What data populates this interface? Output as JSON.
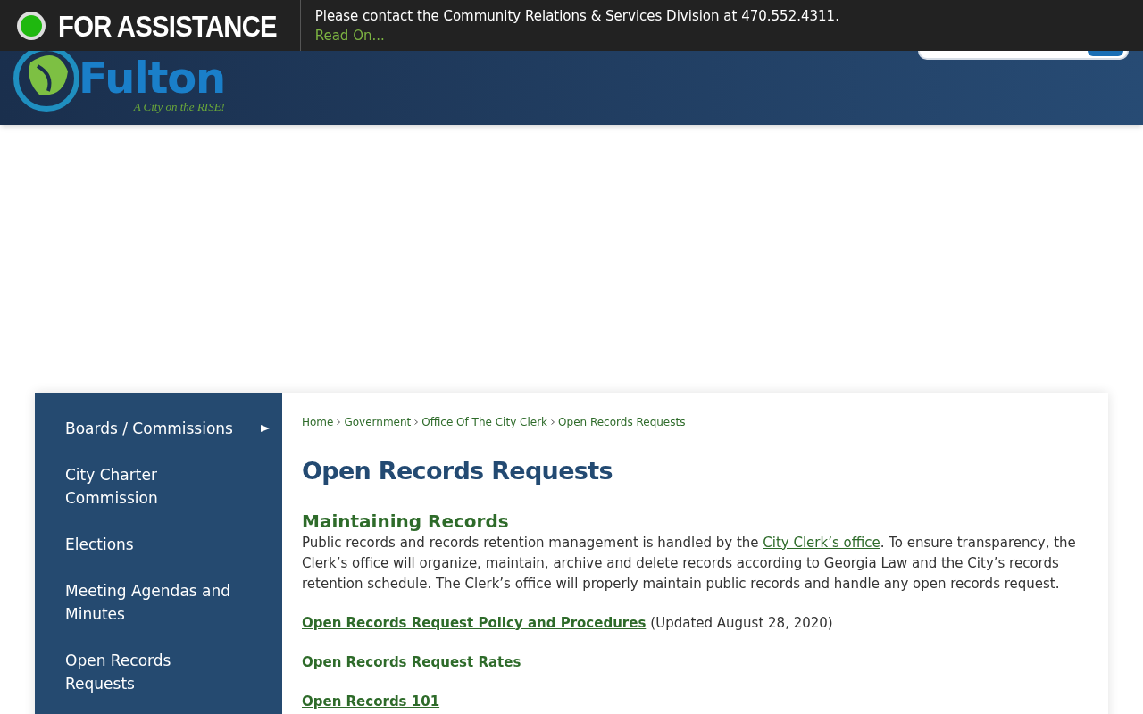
{
  "alert_banner": {
    "title": "FOR ASSISTANCE",
    "message": "Please contact the Community Relations & Services Division at 470.552.4311.",
    "link": "Read On..."
  },
  "header": {
    "logo_text": "Fulton",
    "logo_tagline": "A City on the RISE!"
  },
  "sidebar": {
    "items": [
      {
        "label": "Boards / Commissions",
        "has_submenu": true
      },
      {
        "label": "City Charter Commission",
        "has_submenu": false
      },
      {
        "label": "Elections",
        "has_submenu": false
      },
      {
        "label": "Meeting Agendas and Minutes",
        "has_submenu": false
      },
      {
        "label": "Open Records Requests",
        "has_submenu": false
      }
    ]
  },
  "breadcrumbs": [
    "Home",
    "Government",
    "Office Of The City Clerk",
    "Open Records Requests"
  ],
  "page_title": "Open Records Requests",
  "section_title": "Maintaining Records",
  "paragraph": {
    "before": "Public records and records retention management is handled by the ",
    "link": "City Clerk’s office",
    "after": ". To ensure transparency, the Clerk’s office will organize, maintain, archive and delete records according to Georgia Law and the City’s records retention schedule. The Clerk’s office will properly maintain public records and handle any open records request."
  },
  "links": [
    {
      "label": "Open Records Request Policy and Procedures",
      "note": "(Updated August 28, 2020)"
    },
    {
      "label": "Open Records Request Rates"
    },
    {
      "label": "Open Records 101"
    }
  ]
}
